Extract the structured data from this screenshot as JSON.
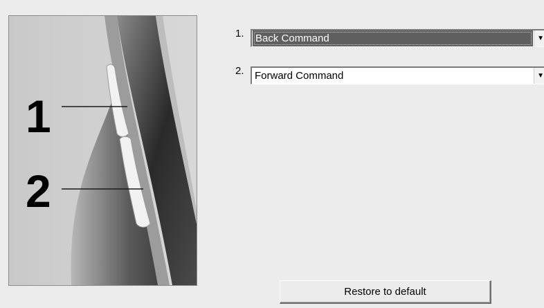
{
  "illustration": {
    "labels": [
      "1",
      "2"
    ]
  },
  "rows": [
    {
      "number": "1.",
      "value": "Back Command",
      "selected": true
    },
    {
      "number": "2.",
      "value": "Forward Command",
      "selected": false
    }
  ],
  "dropdown_icon": "triangle-down-icon",
  "restore_button": {
    "label": "Restore to default"
  }
}
